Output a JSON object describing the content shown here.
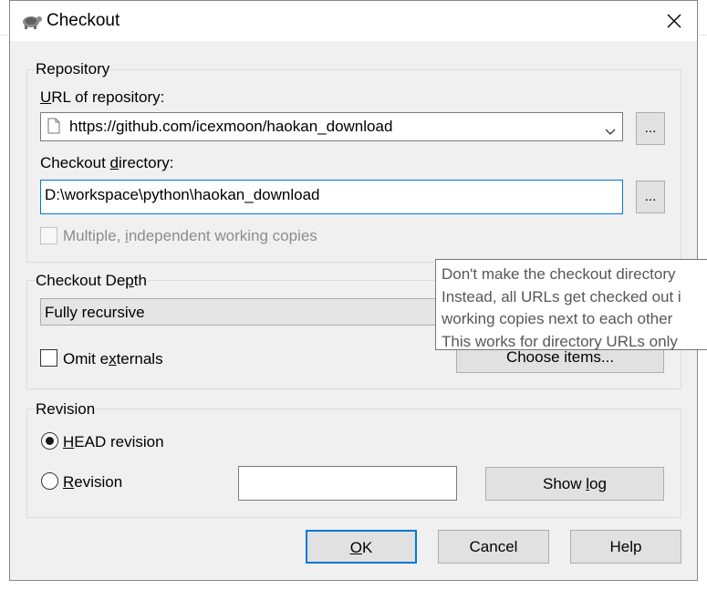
{
  "window": {
    "title": "Checkout"
  },
  "repository": {
    "group_label": "Repository",
    "url_label": "URL of repository:",
    "url_value": "https://github.com/icexmoon/haokan_download",
    "browse_label": "...",
    "dir_label": "Checkout directory:",
    "dir_value": "D:\\workspace\\python\\haokan_download",
    "dir_browse_label": "...",
    "multiple_label": "Multiple, independent working copies"
  },
  "depth": {
    "group_label": "Checkout Depth",
    "selected": "Fully recursive",
    "omit_externals_label": "Omit externals",
    "choose_items_label": "Choose items..."
  },
  "revision": {
    "group_label": "Revision",
    "head_label": "HEAD revision",
    "revision_label": "Revision",
    "revision_value": "",
    "show_log_label": "Show log"
  },
  "buttons": {
    "ok": "OK",
    "cancel": "Cancel",
    "help": "Help"
  },
  "tooltip": {
    "lines": [
      "Don't make the checkout directory",
      "Instead, all URLs get checked out i",
      "working copies next to each other",
      "This works for directory URLs only"
    ]
  },
  "icons": {
    "app": "tortoise-icon",
    "file": "file-icon",
    "dropdown": "chevron-down-icon",
    "close": "close-icon"
  }
}
